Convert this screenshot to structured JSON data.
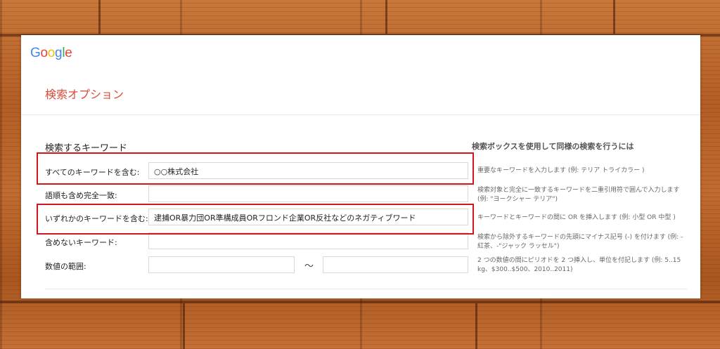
{
  "logo": {
    "text": "Google",
    "letter_colors": [
      "#4285f4",
      "#ea4335",
      "#fbbc05",
      "#4285f4",
      "#34a853",
      "#ea4335"
    ]
  },
  "page_title": "検索オプション",
  "section_title": "検索するキーワード",
  "help_title": "検索ボックスを使用して同様の検索を行うには",
  "rows": [
    {
      "label": "すべてのキーワードを含む:",
      "value": "○○株式会社",
      "help": "重要なキーワードを入力します (例: テリア トライカラー )"
    },
    {
      "label": "語順も含め完全一致:",
      "value": "",
      "help": "検索対象と完全に一致するキーワードを二重引用符で囲んで入力します (例: \"ヨークシャー テリア\")"
    },
    {
      "label": "いずれかのキーワードを含む:",
      "value": "逮捕OR暴力団OR準構成員ORフロンド企業OR反社などのネガティブワード",
      "help": "キーワードとキーワードの間に OR を挿入します (例: 小型 OR 中型 )"
    },
    {
      "label": "含めないキーワード:",
      "value": "",
      "help": "検索から除外するキーワードの先頭にマイナス記号 (-) を付けます (例: -紅茶、-\"ジャック ラッセル\")"
    },
    {
      "label": "数値の範囲:",
      "value_from": "",
      "value_to": "",
      "separator": "〜",
      "help": "2 つの数値の間にピリオドを 2 つ挿入し、単位を付記します (例: 5..15 kg、$300..$500、2010..2011)"
    }
  ],
  "colors": {
    "title_red": "#dd4b39",
    "highlight_red": "#d3151d"
  }
}
